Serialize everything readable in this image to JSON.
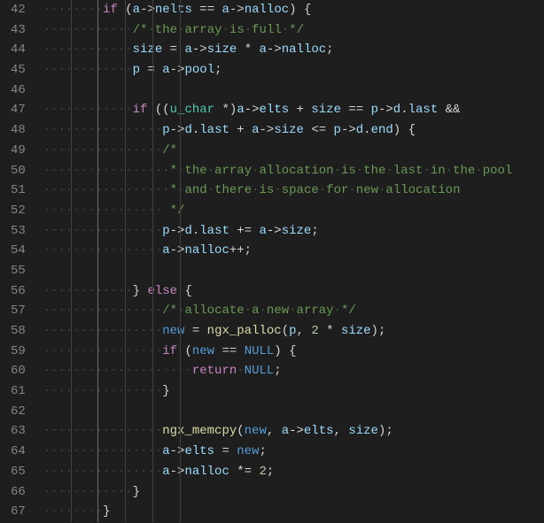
{
  "lines": [
    {
      "num": 42,
      "indent": 2,
      "tokens": [
        {
          "t": "if",
          "c": "c-keyword"
        },
        {
          "t": " (",
          "c": "c-punct"
        },
        {
          "t": "a",
          "c": "c-var"
        },
        {
          "t": "->",
          "c": "c-punct"
        },
        {
          "t": "nelts",
          "c": "c-var"
        },
        {
          "t": " == ",
          "c": "c-punct"
        },
        {
          "t": "a",
          "c": "c-var"
        },
        {
          "t": "->",
          "c": "c-punct"
        },
        {
          "t": "nalloc",
          "c": "c-var"
        },
        {
          "t": ") {",
          "c": "c-punct"
        }
      ]
    },
    {
      "num": 43,
      "indent": 3,
      "tokens": [
        {
          "t": "/* the array is full */",
          "c": "c-comment",
          "ws": true
        }
      ]
    },
    {
      "num": 44,
      "indent": 3,
      "tokens": [
        {
          "t": "size",
          "c": "c-var"
        },
        {
          "t": " = ",
          "c": "c-punct"
        },
        {
          "t": "a",
          "c": "c-var"
        },
        {
          "t": "->",
          "c": "c-punct"
        },
        {
          "t": "size",
          "c": "c-var"
        },
        {
          "t": " * ",
          "c": "c-punct"
        },
        {
          "t": "a",
          "c": "c-var"
        },
        {
          "t": "->",
          "c": "c-punct"
        },
        {
          "t": "nalloc",
          "c": "c-var"
        },
        {
          "t": ";",
          "c": "c-punct"
        }
      ]
    },
    {
      "num": 45,
      "indent": 3,
      "tokens": [
        {
          "t": "p",
          "c": "c-var"
        },
        {
          "t": " = ",
          "c": "c-punct"
        },
        {
          "t": "a",
          "c": "c-var"
        },
        {
          "t": "->",
          "c": "c-punct"
        },
        {
          "t": "pool",
          "c": "c-var"
        },
        {
          "t": ";",
          "c": "c-punct"
        }
      ]
    },
    {
      "num": 46,
      "indent": 0,
      "tokens": []
    },
    {
      "num": 47,
      "indent": 3,
      "tokens": [
        {
          "t": "if",
          "c": "c-keyword"
        },
        {
          "t": " ((",
          "c": "c-punct"
        },
        {
          "t": "u_char",
          "c": "c-type"
        },
        {
          "t": " *)",
          "c": "c-punct"
        },
        {
          "t": "a",
          "c": "c-var"
        },
        {
          "t": "->",
          "c": "c-punct"
        },
        {
          "t": "elts",
          "c": "c-var"
        },
        {
          "t": " + ",
          "c": "c-punct"
        },
        {
          "t": "size",
          "c": "c-var"
        },
        {
          "t": " == ",
          "c": "c-punct"
        },
        {
          "t": "p",
          "c": "c-var"
        },
        {
          "t": "->",
          "c": "c-punct"
        },
        {
          "t": "d",
          "c": "c-var"
        },
        {
          "t": ".",
          "c": "c-punct"
        },
        {
          "t": "last",
          "c": "c-var"
        },
        {
          "t": " &&",
          "c": "c-punct"
        }
      ]
    },
    {
      "num": 48,
      "indent": 4,
      "tokens": [
        {
          "t": "p",
          "c": "c-var"
        },
        {
          "t": "->",
          "c": "c-punct"
        },
        {
          "t": "d",
          "c": "c-var"
        },
        {
          "t": ".",
          "c": "c-punct"
        },
        {
          "t": "last",
          "c": "c-var"
        },
        {
          "t": " + ",
          "c": "c-punct"
        },
        {
          "t": "a",
          "c": "c-var"
        },
        {
          "t": "->",
          "c": "c-punct"
        },
        {
          "t": "size",
          "c": "c-var"
        },
        {
          "t": " <= ",
          "c": "c-punct"
        },
        {
          "t": "p",
          "c": "c-var"
        },
        {
          "t": "->",
          "c": "c-punct"
        },
        {
          "t": "d",
          "c": "c-var"
        },
        {
          "t": ".",
          "c": "c-punct"
        },
        {
          "t": "end",
          "c": "c-var"
        },
        {
          "t": ") {",
          "c": "c-punct"
        }
      ]
    },
    {
      "num": 49,
      "indent": 4,
      "tokens": [
        {
          "t": "/*",
          "c": "c-comment"
        }
      ]
    },
    {
      "num": 50,
      "indent": 4,
      "tokens": [
        {
          "t": " * the array allocation is the last in the pool",
          "c": "c-comment",
          "ws": true
        }
      ]
    },
    {
      "num": 51,
      "indent": 4,
      "tokens": [
        {
          "t": " * and there is space for new allocation",
          "c": "c-comment",
          "ws": true
        }
      ]
    },
    {
      "num": 52,
      "indent": 4,
      "tokens": [
        {
          "t": " */",
          "c": "c-comment"
        }
      ]
    },
    {
      "num": 53,
      "indent": 4,
      "tokens": [
        {
          "t": "p",
          "c": "c-var"
        },
        {
          "t": "->",
          "c": "c-punct"
        },
        {
          "t": "d",
          "c": "c-var"
        },
        {
          "t": ".",
          "c": "c-punct"
        },
        {
          "t": "last",
          "c": "c-var"
        },
        {
          "t": " += ",
          "c": "c-punct"
        },
        {
          "t": "a",
          "c": "c-var"
        },
        {
          "t": "->",
          "c": "c-punct"
        },
        {
          "t": "size",
          "c": "c-var"
        },
        {
          "t": ";",
          "c": "c-punct"
        }
      ]
    },
    {
      "num": 54,
      "indent": 4,
      "tokens": [
        {
          "t": "a",
          "c": "c-var"
        },
        {
          "t": "->",
          "c": "c-punct"
        },
        {
          "t": "nalloc",
          "c": "c-var"
        },
        {
          "t": "++;",
          "c": "c-punct"
        }
      ]
    },
    {
      "num": 55,
      "indent": 0,
      "tokens": []
    },
    {
      "num": 56,
      "indent": 3,
      "tokens": [
        {
          "t": "} ",
          "c": "c-punct"
        },
        {
          "t": "else",
          "c": "c-keyword"
        },
        {
          "t": " {",
          "c": "c-punct"
        }
      ]
    },
    {
      "num": 57,
      "indent": 4,
      "tokens": [
        {
          "t": "/* allocate a new array */",
          "c": "c-comment",
          "ws": true
        }
      ]
    },
    {
      "num": 58,
      "indent": 4,
      "tokens": [
        {
          "t": "new",
          "c": "c-const"
        },
        {
          "t": " = ",
          "c": "c-punct"
        },
        {
          "t": "ngx_palloc",
          "c": "c-func"
        },
        {
          "t": "(",
          "c": "c-punct"
        },
        {
          "t": "p",
          "c": "c-var"
        },
        {
          "t": ", ",
          "c": "c-punct"
        },
        {
          "t": "2",
          "c": "c-num"
        },
        {
          "t": " * ",
          "c": "c-punct"
        },
        {
          "t": "size",
          "c": "c-var"
        },
        {
          "t": ");",
          "c": "c-punct"
        }
      ]
    },
    {
      "num": 59,
      "indent": 4,
      "tokens": [
        {
          "t": "if",
          "c": "c-keyword"
        },
        {
          "t": " (",
          "c": "c-punct"
        },
        {
          "t": "new",
          "c": "c-const"
        },
        {
          "t": " == ",
          "c": "c-punct"
        },
        {
          "t": "NULL",
          "c": "c-const"
        },
        {
          "t": ") {",
          "c": "c-punct"
        }
      ]
    },
    {
      "num": 60,
      "indent": 5,
      "tokens": [
        {
          "t": "return",
          "c": "c-keyword"
        },
        {
          "t": " ",
          "c": "c-punct",
          "ws": true
        },
        {
          "t": "NULL",
          "c": "c-const"
        },
        {
          "t": ";",
          "c": "c-punct"
        }
      ]
    },
    {
      "num": 61,
      "indent": 4,
      "tokens": [
        {
          "t": "}",
          "c": "c-punct"
        }
      ]
    },
    {
      "num": 62,
      "indent": 0,
      "tokens": []
    },
    {
      "num": 63,
      "indent": 4,
      "tokens": [
        {
          "t": "ngx_memcpy",
          "c": "c-func"
        },
        {
          "t": "(",
          "c": "c-punct"
        },
        {
          "t": "new",
          "c": "c-const"
        },
        {
          "t": ", ",
          "c": "c-punct"
        },
        {
          "t": "a",
          "c": "c-var"
        },
        {
          "t": "->",
          "c": "c-punct"
        },
        {
          "t": "elts",
          "c": "c-var"
        },
        {
          "t": ", ",
          "c": "c-punct"
        },
        {
          "t": "size",
          "c": "c-var"
        },
        {
          "t": ");",
          "c": "c-punct"
        }
      ]
    },
    {
      "num": 64,
      "indent": 4,
      "tokens": [
        {
          "t": "a",
          "c": "c-var"
        },
        {
          "t": "->",
          "c": "c-punct"
        },
        {
          "t": "elts",
          "c": "c-var"
        },
        {
          "t": " = ",
          "c": "c-punct"
        },
        {
          "t": "new",
          "c": "c-const"
        },
        {
          "t": ";",
          "c": "c-punct"
        }
      ]
    },
    {
      "num": 65,
      "indent": 4,
      "tokens": [
        {
          "t": "a",
          "c": "c-var"
        },
        {
          "t": "->",
          "c": "c-punct"
        },
        {
          "t": "nalloc",
          "c": "c-var"
        },
        {
          "t": " *= ",
          "c": "c-punct"
        },
        {
          "t": "2",
          "c": "c-num"
        },
        {
          "t": ";",
          "c": "c-punct"
        }
      ]
    },
    {
      "num": 66,
      "indent": 3,
      "tokens": [
        {
          "t": "}",
          "c": "c-punct"
        }
      ]
    },
    {
      "num": 67,
      "indent": 2,
      "tokens": [
        {
          "t": "}",
          "c": "c-punct"
        }
      ]
    }
  ],
  "indent_width_chars": 4,
  "guide_levels_always": 5,
  "active_guide_level": 2
}
